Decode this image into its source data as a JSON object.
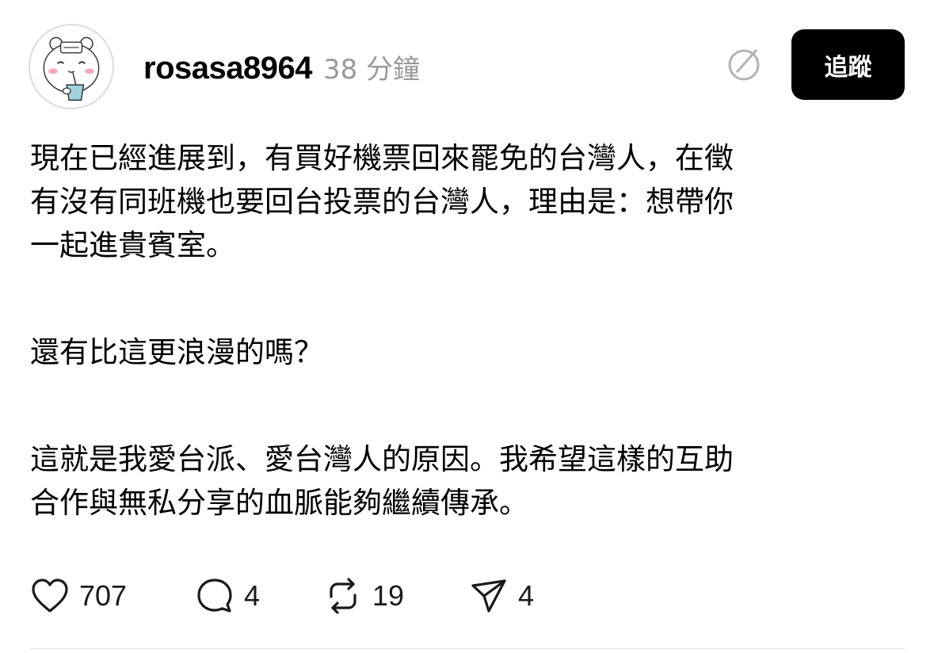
{
  "post": {
    "username": "rosasa8964",
    "timestamp": "38 分鐘",
    "follow_label": "追蹤",
    "body": {
      "paragraph1": [
        "現在已經進展到，有買好機票回來罷免的台灣人，在徵",
        "有沒有同班機也要回台投票的台灣人，理由是：想帶你",
        "一起進貴賓室。"
      ],
      "paragraph2": [
        "還有比這更浪漫的嗎？"
      ],
      "paragraph3": [
        "這就是我愛台派、愛台灣人的原因。我希望這樣的互助",
        "合作與無私分享的血脈能夠繼續傳承。"
      ]
    },
    "actions": {
      "likes": "707",
      "replies": "4",
      "reposts": "19",
      "shares": "4"
    },
    "icons": {
      "avatar": "cartoon-bear-avatar",
      "verify": "circle-slash-icon",
      "like": "heart-icon",
      "reply": "speech-bubble-icon",
      "repost": "repost-arrows-icon",
      "share": "paper-plane-icon"
    },
    "colors": {
      "follow_button_bg": "#000000",
      "timestamp": "#999999",
      "avatar_blush": "#f4a7b9",
      "avatar_cup": "#9fd3e0"
    }
  }
}
